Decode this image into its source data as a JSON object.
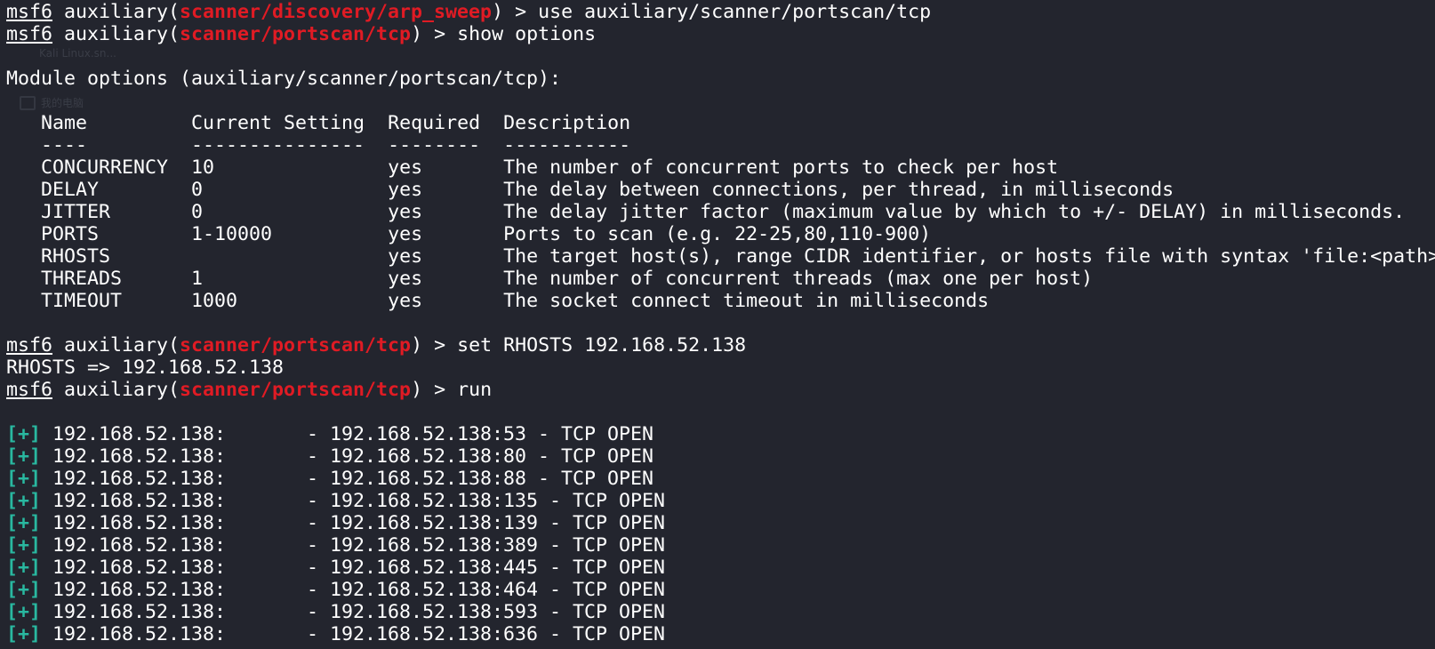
{
  "colors": {
    "background": "#23252e",
    "text": "#ffffff",
    "module_red": "#e01b24",
    "plus_teal": "#29b8a0"
  },
  "background_ghost": {
    "label1": "Kali Linux.sn...",
    "label2": "我的电脑"
  },
  "prompt": "msf6",
  "module_prefix": "auxiliary(",
  "module_suffix": ")",
  "commands": [
    {
      "module": "scanner/discovery/arp_sweep",
      "command": " > use auxiliary/scanner/portscan/tcp"
    },
    {
      "module": "scanner/portscan/tcp",
      "command": " > show options"
    }
  ],
  "module_options_header": "Module options (auxiliary/scanner/portscan/tcp):",
  "options_table": {
    "headers": [
      "Name",
      "Current Setting",
      "Required",
      "Description"
    ],
    "separators": [
      "----",
      "---------------",
      "--------",
      "-----------"
    ],
    "rows": [
      [
        "CONCURRENCY",
        "10",
        "yes",
        "The number of concurrent ports to check per host"
      ],
      [
        "DELAY",
        "0",
        "yes",
        "The delay between connections, per thread, in milliseconds"
      ],
      [
        "JITTER",
        "0",
        "yes",
        "The delay jitter factor (maximum value by which to +/- DELAY) in milliseconds."
      ],
      [
        "PORTS",
        "1-10000",
        "yes",
        "Ports to scan (e.g. 22-25,80,110-900)"
      ],
      [
        "RHOSTS",
        "",
        "yes",
        "The target host(s), range CIDR identifier, or hosts file with syntax 'file:<path>'"
      ],
      [
        "THREADS",
        "1",
        "yes",
        "The number of concurrent threads (max one per host)"
      ],
      [
        "TIMEOUT",
        "1000",
        "yes",
        "The socket connect timeout in milliseconds"
      ]
    ]
  },
  "commands2": [
    {
      "module": "scanner/portscan/tcp",
      "command": " > set RHOSTS 192.168.52.138"
    }
  ],
  "rhosts_output": "RHOSTS => 192.168.52.138",
  "commands3": [
    {
      "module": "scanner/portscan/tcp",
      "command": " > run"
    }
  ],
  "scan_results": {
    "marker": "[+]",
    "lines": [
      " 192.168.52.138:       - 192.168.52.138:53 - TCP OPEN",
      " 192.168.52.138:       - 192.168.52.138:80 - TCP OPEN",
      " 192.168.52.138:       - 192.168.52.138:88 - TCP OPEN",
      " 192.168.52.138:       - 192.168.52.138:135 - TCP OPEN",
      " 192.168.52.138:       - 192.168.52.138:139 - TCP OPEN",
      " 192.168.52.138:       - 192.168.52.138:389 - TCP OPEN",
      " 192.168.52.138:       - 192.168.52.138:445 - TCP OPEN",
      " 192.168.52.138:       - 192.168.52.138:464 - TCP OPEN",
      " 192.168.52.138:       - 192.168.52.138:593 - TCP OPEN",
      " 192.168.52.138:       - 192.168.52.138:636 - TCP OPEN"
    ]
  }
}
